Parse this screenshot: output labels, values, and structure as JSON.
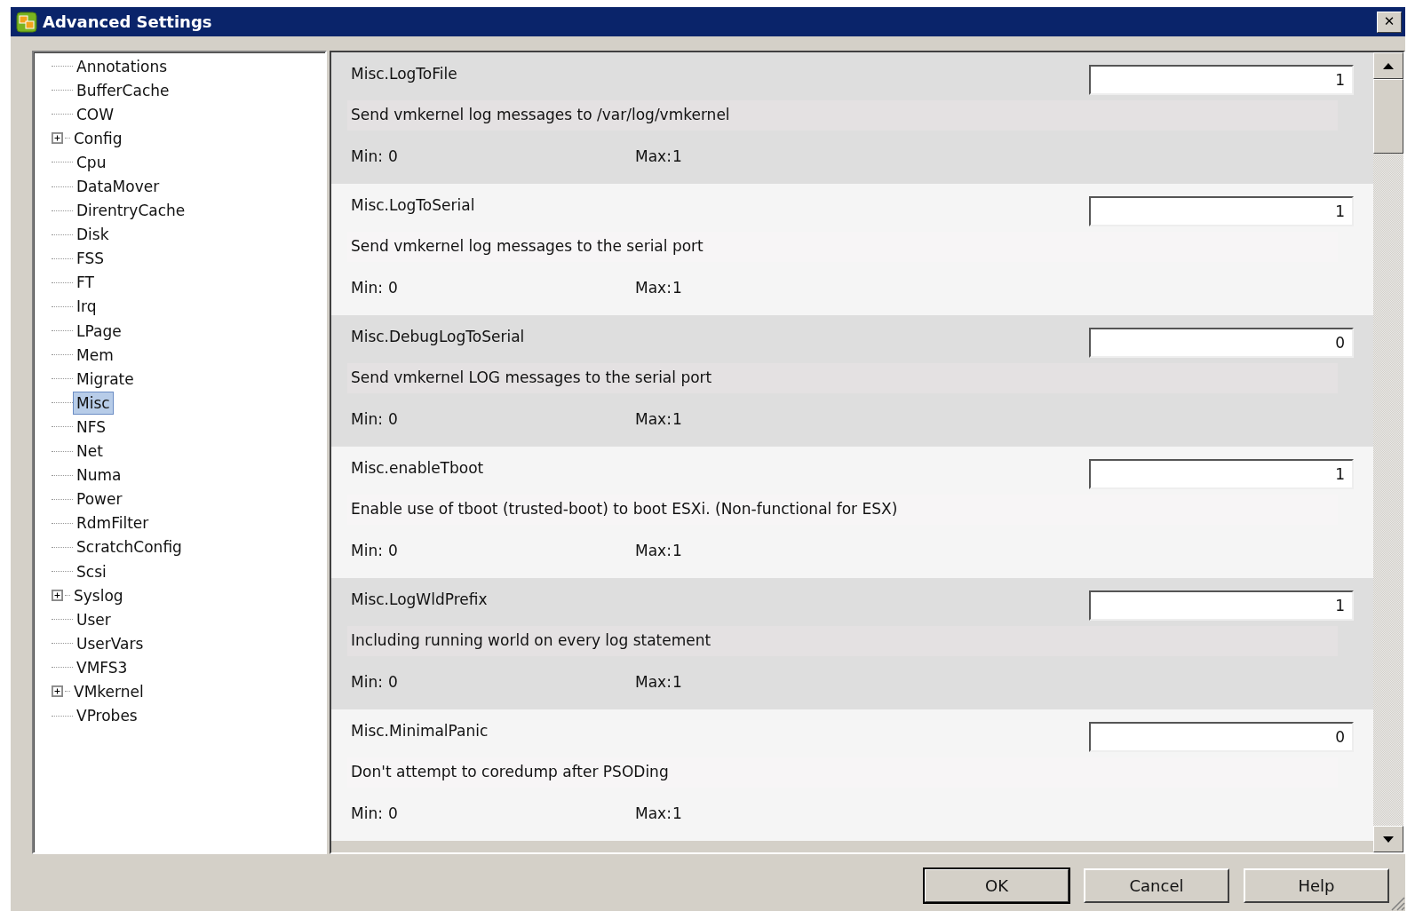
{
  "window": {
    "title": "Advanced Settings",
    "close": "✕"
  },
  "tree": {
    "items": [
      {
        "label": "Annotations",
        "expandable": false,
        "selected": false
      },
      {
        "label": "BufferCache",
        "expandable": false,
        "selected": false
      },
      {
        "label": "COW",
        "expandable": false,
        "selected": false
      },
      {
        "label": "Config",
        "expandable": true,
        "selected": false
      },
      {
        "label": "Cpu",
        "expandable": false,
        "selected": false
      },
      {
        "label": "DataMover",
        "expandable": false,
        "selected": false
      },
      {
        "label": "DirentryCache",
        "expandable": false,
        "selected": false
      },
      {
        "label": "Disk",
        "expandable": false,
        "selected": false
      },
      {
        "label": "FSS",
        "expandable": false,
        "selected": false
      },
      {
        "label": "FT",
        "expandable": false,
        "selected": false
      },
      {
        "label": "Irq",
        "expandable": false,
        "selected": false
      },
      {
        "label": "LPage",
        "expandable": false,
        "selected": false
      },
      {
        "label": "Mem",
        "expandable": false,
        "selected": false
      },
      {
        "label": "Migrate",
        "expandable": false,
        "selected": false
      },
      {
        "label": "Misc",
        "expandable": false,
        "selected": true
      },
      {
        "label": "NFS",
        "expandable": false,
        "selected": false
      },
      {
        "label": "Net",
        "expandable": false,
        "selected": false
      },
      {
        "label": "Numa",
        "expandable": false,
        "selected": false
      },
      {
        "label": "Power",
        "expandable": false,
        "selected": false
      },
      {
        "label": "RdmFilter",
        "expandable": false,
        "selected": false
      },
      {
        "label": "ScratchConfig",
        "expandable": false,
        "selected": false
      },
      {
        "label": "Scsi",
        "expandable": false,
        "selected": false
      },
      {
        "label": "Syslog",
        "expandable": true,
        "selected": false
      },
      {
        "label": "User",
        "expandable": false,
        "selected": false
      },
      {
        "label": "UserVars",
        "expandable": false,
        "selected": false
      },
      {
        "label": "VMFS3",
        "expandable": false,
        "selected": false
      },
      {
        "label": "VMkernel",
        "expandable": true,
        "selected": false
      },
      {
        "label": "VProbes",
        "expandable": false,
        "selected": false
      }
    ]
  },
  "settings": [
    {
      "name": "Misc.LogToFile",
      "value": "1",
      "description": "Send vmkernel log messages to /var/log/vmkernel",
      "min_label": "Min:",
      "min": "0",
      "max_label": "Max:",
      "max": "1"
    },
    {
      "name": "Misc.LogToSerial",
      "value": "1",
      "description": "Send vmkernel log messages to the serial port",
      "min_label": "Min:",
      "min": "0",
      "max_label": "Max:",
      "max": "1"
    },
    {
      "name": "Misc.DebugLogToSerial",
      "value": "0",
      "description": "Send vmkernel LOG messages to the serial port",
      "min_label": "Min:",
      "min": "0",
      "max_label": "Max:",
      "max": "1"
    },
    {
      "name": "Misc.enableTboot",
      "value": "1",
      "description": "Enable use of tboot (trusted-boot) to boot ESXi. (Non-functional for ESX)",
      "min_label": "Min:",
      "min": "0",
      "max_label": "Max:",
      "max": "1"
    },
    {
      "name": "Misc.LogWldPrefix",
      "value": "1",
      "description": "Including running world on every log statement",
      "min_label": "Min:",
      "min": "0",
      "max_label": "Max:",
      "max": "1"
    },
    {
      "name": "Misc.MinimalPanic",
      "value": "0",
      "description": "Don't attempt to coredump after PSODing",
      "min_label": "Min:",
      "min": "0",
      "max_label": "Max:",
      "max": "1"
    }
  ],
  "buttons": [
    {
      "label": "OK",
      "default": true
    },
    {
      "label": "Cancel",
      "default": false
    },
    {
      "label": "Help",
      "default": false
    }
  ]
}
